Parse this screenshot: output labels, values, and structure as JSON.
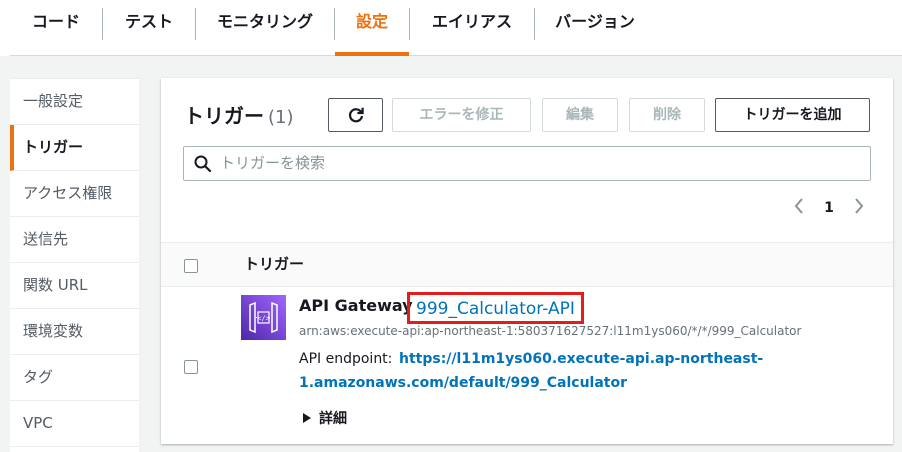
{
  "tabs": [
    {
      "label": "コード"
    },
    {
      "label": "テスト"
    },
    {
      "label": "モニタリング"
    },
    {
      "label": "設定"
    },
    {
      "label": "エイリアス"
    },
    {
      "label": "バージョン"
    }
  ],
  "active_tab": "設定",
  "sidebar": {
    "items": [
      {
        "label": "一般設定"
      },
      {
        "label": "トリガー"
      },
      {
        "label": "アクセス権限"
      },
      {
        "label": "送信先"
      },
      {
        "label": "関数 URL"
      },
      {
        "label": "環境変数"
      },
      {
        "label": "タグ"
      },
      {
        "label": "VPC"
      }
    ],
    "active": "トリガー"
  },
  "panel": {
    "title": "トリガー",
    "count": "(1)",
    "buttons": {
      "fix": "エラーを修正",
      "edit": "編集",
      "delete": "削除",
      "add": "トリガーを追加"
    },
    "search_placeholder": "トリガーを検索",
    "page": "1",
    "column_header": "トリガー"
  },
  "trigger": {
    "service": "API Gateway",
    "name": "999_Calculator-API",
    "arn": "arn:aws:execute-api:ap-northeast-1:580371627527:l11m1ys060/*/*/999_Calculator",
    "endpoint_label": "API endpoint:",
    "endpoint_line1": "https://l11m1ys060.execute-api.ap-northeast-",
    "endpoint_line2": "1.amazonaws.com/default/999_Calculator",
    "details": "詳細"
  },
  "colors": {
    "accent": "#ec7211",
    "link": "#0073bb",
    "highlight_box": "#e31c1c",
    "api_gateway_icon": "#8c4fff"
  }
}
